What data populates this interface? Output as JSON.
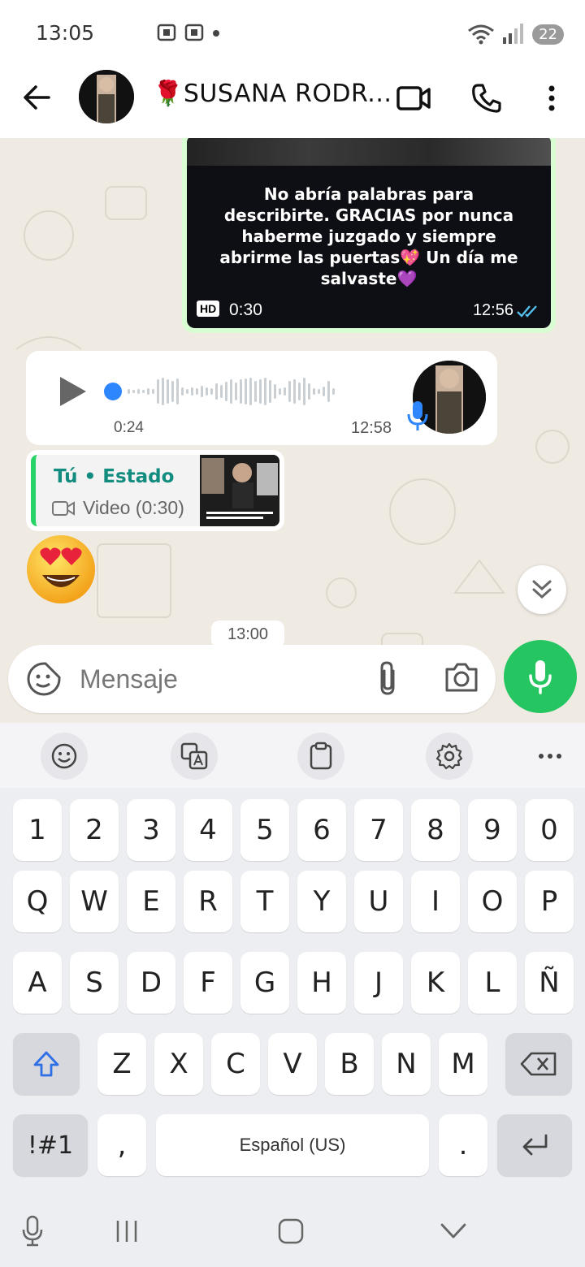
{
  "status_bar": {
    "time": "13:05",
    "battery": "22"
  },
  "header": {
    "contact_name": "🌹SUSANA RODR..."
  },
  "messages": {
    "video": {
      "caption": "No abría palabras para describirte. GRACIAS por nunca haberme juzgado y siempre abrirme las puertas💖 Un día me salvaste💜",
      "hd": "HD",
      "duration": "0:30",
      "time": "12:56"
    },
    "voice": {
      "duration": "0:24",
      "time": "12:58"
    },
    "status_reply": {
      "title": "Tú • Estado",
      "subtitle": "Video (0:30)"
    },
    "emoji": "😍",
    "date_chip": "13:00"
  },
  "composer": {
    "placeholder": "Mensaje"
  },
  "keyboard": {
    "row_numbers": [
      "1",
      "2",
      "3",
      "4",
      "5",
      "6",
      "7",
      "8",
      "9",
      "0"
    ],
    "row_1": [
      "Q",
      "W",
      "E",
      "R",
      "T",
      "Y",
      "U",
      "I",
      "O",
      "P"
    ],
    "row_2": [
      "A",
      "S",
      "D",
      "F",
      "G",
      "H",
      "J",
      "K",
      "L",
      "Ñ"
    ],
    "row_3": [
      "Z",
      "X",
      "C",
      "V",
      "B",
      "N",
      "M"
    ],
    "symbols_label": "!#1",
    "comma": ",",
    "space_label": "Español (US)",
    "period": "."
  },
  "colors": {
    "accent": "#25c661",
    "chat_bg": "#efeae2",
    "outgoing": "#d9fdd3",
    "read_ticks": "#53bdeb"
  }
}
